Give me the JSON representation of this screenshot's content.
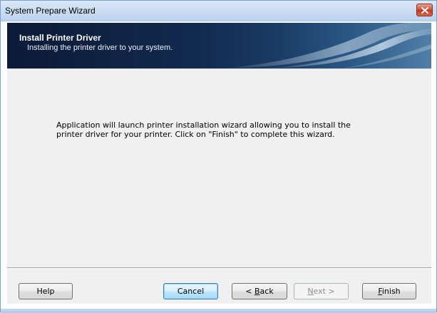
{
  "window": {
    "title": "System Prepare Wizard"
  },
  "banner": {
    "title": "Install Printer Driver",
    "subtitle": "Installing the printer driver to your system."
  },
  "content": {
    "message": "Application will launch printer installation wizard allowing you to install the printer driver for your printer. Click on \"Finish\" to complete this wizard."
  },
  "buttons": {
    "help": "Help",
    "cancel": "Cancel",
    "back_prefix": "< ",
    "back_mnemonic": "B",
    "back_rest": "ack",
    "next_mnemonic": "N",
    "next_rest": "ext >",
    "finish_mnemonic": "F",
    "finish_rest": "inish",
    "next_enabled": false
  },
  "colors": {
    "banner_dark": "#0b1a37",
    "close_button": "#c13a22",
    "default_button_border": "#3c7fb1"
  },
  "icons": {
    "close": "close-icon"
  }
}
